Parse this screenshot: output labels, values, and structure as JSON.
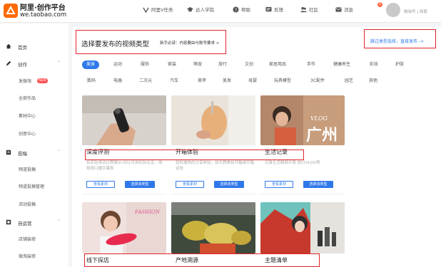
{
  "header": {
    "logo_title": "阿里·创作平台",
    "logo_url": "we.taobao.com",
    "nav": [
      {
        "label": "阿里V任务",
        "icon": "v-icon"
      },
      {
        "label": "达人学院",
        "icon": "graduation-cap-icon"
      },
      {
        "label": "帮助",
        "icon": "help-icon"
      },
      {
        "label": "反馈",
        "icon": "feedback-icon"
      },
      {
        "label": "社区",
        "icon": "community-icon"
      },
      {
        "label": "消息",
        "icon": "message-icon"
      }
    ],
    "message_count": "5",
    "user_name": "微淘号 | 商家"
  },
  "sidebar": {
    "items": [
      {
        "label": "首页",
        "icon": "home-icon"
      },
      {
        "label": "创作",
        "icon": "create-icon",
        "expanded": true
      },
      {
        "label": "投稿",
        "icon": "submit-icon",
        "expanded": true
      },
      {
        "label": "自运营",
        "icon": "operate-icon",
        "expanded": true
      }
    ],
    "create_sub": [
      "发微淘",
      "全部作品",
      "素材中心",
      "创意中心"
    ],
    "new_badge": "NEW",
    "submit_sub": [
      "频道投稿",
      "频道投稿管理",
      "活动投稿"
    ],
    "operate_sub": [
      "店铺装修",
      "微淘装修"
    ]
  },
  "main": {
    "title": "选择要发布的视频类型",
    "subtitle": "新手必读：内容要由与账号要求 >",
    "top_link": "跳过类型选择，直接发布 ->",
    "categories": [
      "美食",
      "运动",
      "服饰",
      "家装",
      "萌宠",
      "旅行",
      "文创",
      "家居用品",
      "手作",
      "健康养生",
      "彩妆",
      "护肤",
      "数码",
      "电器",
      "二次元",
      "汽车",
      "美甲",
      "美发",
      "母婴",
      "玩具模型",
      "3C配件",
      "园艺",
      "其他"
    ],
    "active_category": "美食",
    "cards": [
      {
        "title": "深度评测",
        "desc": "有实验测试过程展示/对比可用经验论证，用视频口播字幕表",
        "btn_outline": "查看素材",
        "btn_solid": "选择该类型"
      },
      {
        "title": "开箱体验",
        "desc": "轻松愉快的分享体验，如大牌美妆开箱或开箱试吃",
        "btn_outline": "查看素材",
        "btn_solid": "选择该类型"
      },
      {
        "title": "生活记录",
        "desc": "记录生活精简片段 旅行VLOG等",
        "btn_outline": "查看素材",
        "btn_solid": "选择该类型"
      },
      {
        "title": "线下探店"
      },
      {
        "title": "产地溯源"
      },
      {
        "title": "主题清单"
      }
    ],
    "image_texts": {
      "vlog": "VLOG",
      "city": "广州",
      "fashion": "FASHION"
    }
  }
}
